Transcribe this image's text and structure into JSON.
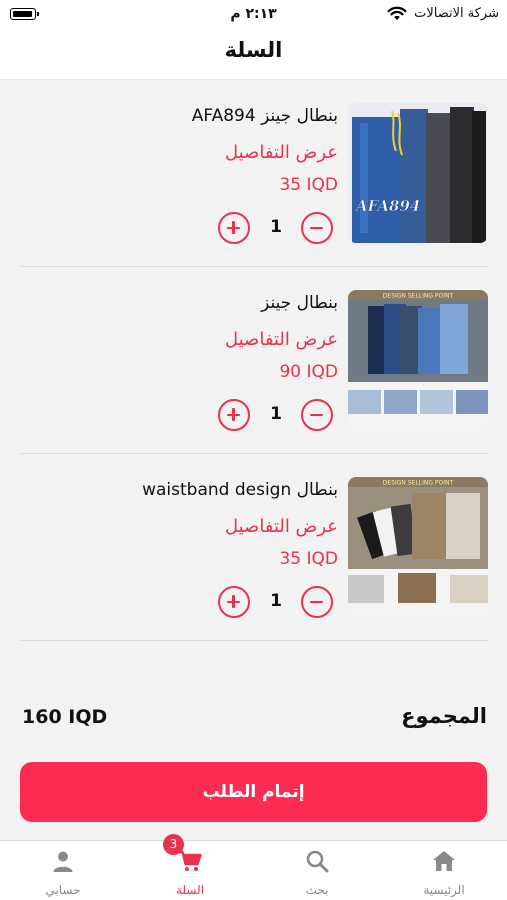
{
  "status_bar": {
    "time": "٢:١٣ م",
    "carrier": "شركة الاتصالات"
  },
  "header": {
    "title": "السلة"
  },
  "cart": {
    "items": [
      {
        "name": "بنطال جينز AFA894",
        "details_label": "عرض التفاصيل",
        "price": "35 IQD",
        "quantity": "1",
        "image_watermark": "AFA894"
      },
      {
        "name": "بنطال جينز",
        "details_label": "عرض التفاصيل",
        "price": "90 IQD",
        "quantity": "1",
        "image_banner": "DESIGN SELLING POINT"
      },
      {
        "name": "بنطال waistband design",
        "details_label": "عرض التفاصيل",
        "price": "35 IQD",
        "quantity": "1",
        "image_banner": "DESIGN SELLING POINT"
      }
    ]
  },
  "summary": {
    "total_label": "المجموع",
    "total_value": "160 IQD"
  },
  "checkout": {
    "label": "إتمام الطلب"
  },
  "tab_bar": {
    "tabs": [
      {
        "label": "حسابي",
        "icon": "person-icon"
      },
      {
        "label": "السلة",
        "icon": "cart-icon",
        "badge": "3"
      },
      {
        "label": "بحث",
        "icon": "search-icon"
      },
      {
        "label": "الرئيسية",
        "icon": "home-icon"
      }
    ]
  },
  "colors": {
    "accent": "#e8324f",
    "checkout_button": "#fb2b52",
    "background": "#f2f2f2"
  }
}
